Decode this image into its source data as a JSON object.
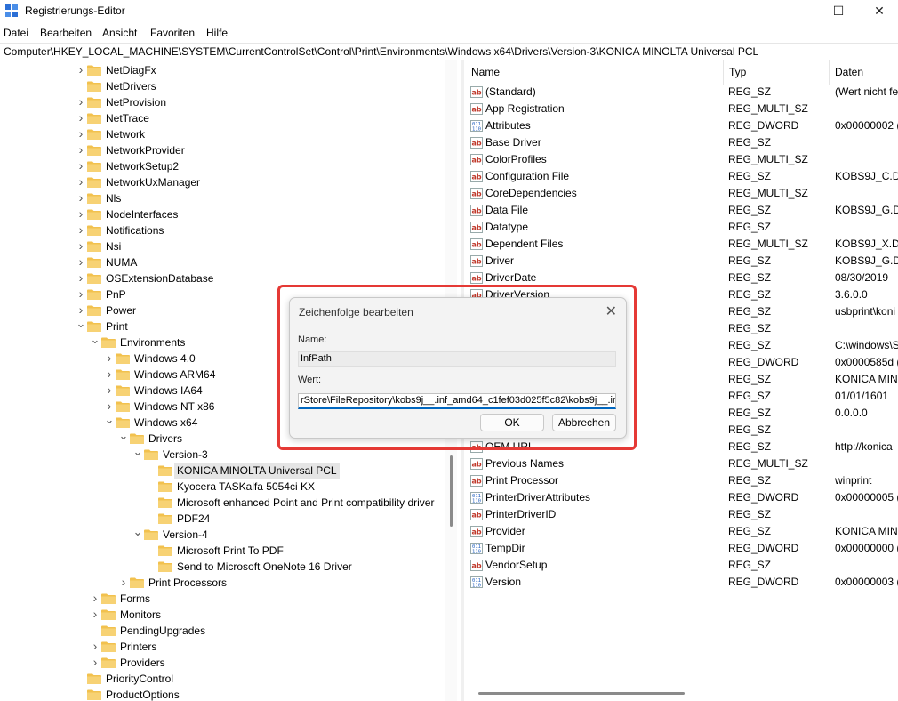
{
  "window": {
    "title": "Registrierungs-Editor",
    "minimize": "—",
    "maximize": "☐",
    "close": "✕"
  },
  "menu": [
    "Datei",
    "Bearbeiten",
    "Ansicht",
    "Favoriten",
    "Hilfe"
  ],
  "address": "Computer\\HKEY_LOCAL_MACHINE\\SYSTEM\\CurrentControlSet\\Control\\Print\\Environments\\Windows x64\\Drivers\\Version-3\\KONICA MINOLTA Universal PCL",
  "tree": [
    {
      "label": "NetDiagFx",
      "level": 0,
      "chevron": "right"
    },
    {
      "label": "NetDrivers",
      "level": 0,
      "chevron": "none"
    },
    {
      "label": "NetProvision",
      "level": 0,
      "chevron": "right"
    },
    {
      "label": "NetTrace",
      "level": 0,
      "chevron": "right"
    },
    {
      "label": "Network",
      "level": 0,
      "chevron": "right"
    },
    {
      "label": "NetworkProvider",
      "level": 0,
      "chevron": "right"
    },
    {
      "label": "NetworkSetup2",
      "level": 0,
      "chevron": "right"
    },
    {
      "label": "NetworkUxManager",
      "level": 0,
      "chevron": "right"
    },
    {
      "label": "Nls",
      "level": 0,
      "chevron": "right"
    },
    {
      "label": "NodeInterfaces",
      "level": 0,
      "chevron": "right"
    },
    {
      "label": "Notifications",
      "level": 0,
      "chevron": "right"
    },
    {
      "label": "Nsi",
      "level": 0,
      "chevron": "right"
    },
    {
      "label": "NUMA",
      "level": 0,
      "chevron": "right"
    },
    {
      "label": "OSExtensionDatabase",
      "level": 0,
      "chevron": "right"
    },
    {
      "label": "PnP",
      "level": 0,
      "chevron": "right"
    },
    {
      "label": "Power",
      "level": 0,
      "chevron": "right"
    },
    {
      "label": "Print",
      "level": 0,
      "chevron": "down"
    },
    {
      "label": "Environments",
      "level": 1,
      "chevron": "down"
    },
    {
      "label": "Windows 4.0",
      "level": 2,
      "chevron": "right"
    },
    {
      "label": "Windows ARM64",
      "level": 2,
      "chevron": "right"
    },
    {
      "label": "Windows IA64",
      "level": 2,
      "chevron": "right"
    },
    {
      "label": "Windows NT x86",
      "level": 2,
      "chevron": "right"
    },
    {
      "label": "Windows x64",
      "level": 2,
      "chevron": "down"
    },
    {
      "label": "Drivers",
      "level": 3,
      "chevron": "down"
    },
    {
      "label": "Version-3",
      "level": 4,
      "chevron": "down"
    },
    {
      "label": "KONICA MINOLTA Universal PCL",
      "level": 5,
      "chevron": "none",
      "selected": true
    },
    {
      "label": "Kyocera TASKalfa 5054ci KX",
      "level": 5,
      "chevron": "none"
    },
    {
      "label": "Microsoft enhanced Point and Print compatibility driver",
      "level": 5,
      "chevron": "none"
    },
    {
      "label": "PDF24",
      "level": 5,
      "chevron": "none"
    },
    {
      "label": "Version-4",
      "level": 4,
      "chevron": "down"
    },
    {
      "label": "Microsoft Print To PDF",
      "level": 5,
      "chevron": "none"
    },
    {
      "label": "Send to Microsoft OneNote 16 Driver",
      "level": 5,
      "chevron": "none"
    },
    {
      "label": "Print Processors",
      "level": 3,
      "chevron": "right"
    },
    {
      "label": "Forms",
      "level": 1,
      "chevron": "right"
    },
    {
      "label": "Monitors",
      "level": 1,
      "chevron": "right"
    },
    {
      "label": "PendingUpgrades",
      "level": 1,
      "chevron": "none"
    },
    {
      "label": "Printers",
      "level": 1,
      "chevron": "right"
    },
    {
      "label": "Providers",
      "level": 1,
      "chevron": "right"
    },
    {
      "label": "PriorityControl",
      "level": 0,
      "chevron": "none"
    },
    {
      "label": "ProductOptions",
      "level": 0,
      "chevron": "none"
    }
  ],
  "columns": {
    "name": "Name",
    "type": "Typ",
    "data": "Daten"
  },
  "values": [
    {
      "name": "(Standard)",
      "type": "REG_SZ",
      "data": "(Wert nicht fe",
      "icon": "string"
    },
    {
      "name": "App Registration",
      "type": "REG_MULTI_SZ",
      "data": "",
      "icon": "string"
    },
    {
      "name": "Attributes",
      "type": "REG_DWORD",
      "data": "0x00000002 (2",
      "icon": "binary"
    },
    {
      "name": "Base Driver",
      "type": "REG_SZ",
      "data": "",
      "icon": "string"
    },
    {
      "name": "ColorProfiles",
      "type": "REG_MULTI_SZ",
      "data": "",
      "icon": "string"
    },
    {
      "name": "Configuration File",
      "type": "REG_SZ",
      "data": "KOBS9J_C.DLL",
      "icon": "string"
    },
    {
      "name": "CoreDependencies",
      "type": "REG_MULTI_SZ",
      "data": "",
      "icon": "string"
    },
    {
      "name": "Data File",
      "type": "REG_SZ",
      "data": "KOBS9J_G.DLL",
      "icon": "string"
    },
    {
      "name": "Datatype",
      "type": "REG_SZ",
      "data": "",
      "icon": "string"
    },
    {
      "name": "Dependent Files",
      "type": "REG_MULTI_SZ",
      "data": "KOBS9J_X.DLL",
      "icon": "string"
    },
    {
      "name": "Driver",
      "type": "REG_SZ",
      "data": "KOBS9J_G.DLL",
      "icon": "string"
    },
    {
      "name": "DriverDate",
      "type": "REG_SZ",
      "data": "08/30/2019",
      "icon": "string"
    },
    {
      "name": "DriverVersion",
      "type": "REG_SZ",
      "data": "3.6.0.0",
      "icon": "string"
    },
    {
      "name": "",
      "type": "REG_SZ",
      "data": "usbprint\\koni",
      "icon": "string"
    },
    {
      "name": "",
      "type": "REG_SZ",
      "data": "",
      "icon": "string"
    },
    {
      "name": "",
      "type": "REG_SZ",
      "data": "C:\\windows\\S",
      "icon": "string"
    },
    {
      "name": "",
      "type": "REG_DWORD",
      "data": "0x0000585d (2",
      "icon": "binary"
    },
    {
      "name": "",
      "type": "REG_SZ",
      "data": "KONICA MINO",
      "icon": "string"
    },
    {
      "name": "",
      "type": "REG_SZ",
      "data": "01/01/1601",
      "icon": "string"
    },
    {
      "name": "",
      "type": "REG_SZ",
      "data": "0.0.0.0",
      "icon": "string"
    },
    {
      "name": "",
      "type": "REG_SZ",
      "data": "",
      "icon": "string"
    },
    {
      "name": "OEM URL",
      "type": "REG_SZ",
      "data": "http://konica",
      "icon": "string"
    },
    {
      "name": "Previous Names",
      "type": "REG_MULTI_SZ",
      "data": "",
      "icon": "string"
    },
    {
      "name": "Print Processor",
      "type": "REG_SZ",
      "data": "winprint",
      "icon": "string"
    },
    {
      "name": "PrinterDriverAttributes",
      "type": "REG_DWORD",
      "data": "0x00000005 (5",
      "icon": "binary"
    },
    {
      "name": "PrinterDriverID",
      "type": "REG_SZ",
      "data": "",
      "icon": "string"
    },
    {
      "name": "Provider",
      "type": "REG_SZ",
      "data": "KONICA MINO",
      "icon": "string"
    },
    {
      "name": "TempDir",
      "type": "REG_DWORD",
      "data": "0x00000000 (0",
      "icon": "binary"
    },
    {
      "name": "VendorSetup",
      "type": "REG_SZ",
      "data": "",
      "icon": "string"
    },
    {
      "name": "Version",
      "type": "REG_DWORD",
      "data": "0x00000003 (3",
      "icon": "binary"
    }
  ],
  "dialog": {
    "title": "Zeichenfolge bearbeiten",
    "close": "✕",
    "name_label": "Name:",
    "name_value": "InfPath",
    "value_label": "Wert:",
    "value_text": "rStore\\FileRepository\\kobs9j__.inf_amd64_c1fef03d025f5c82\\kobs9j__.inf",
    "ok": "OK",
    "cancel": "Abbrechen"
  },
  "colors": {
    "folder": "#f2c14e",
    "accent": "#0067c0",
    "highlight": "#e53935",
    "string_icon": "#c0392b",
    "binary_icon": "#1f5fbf"
  }
}
